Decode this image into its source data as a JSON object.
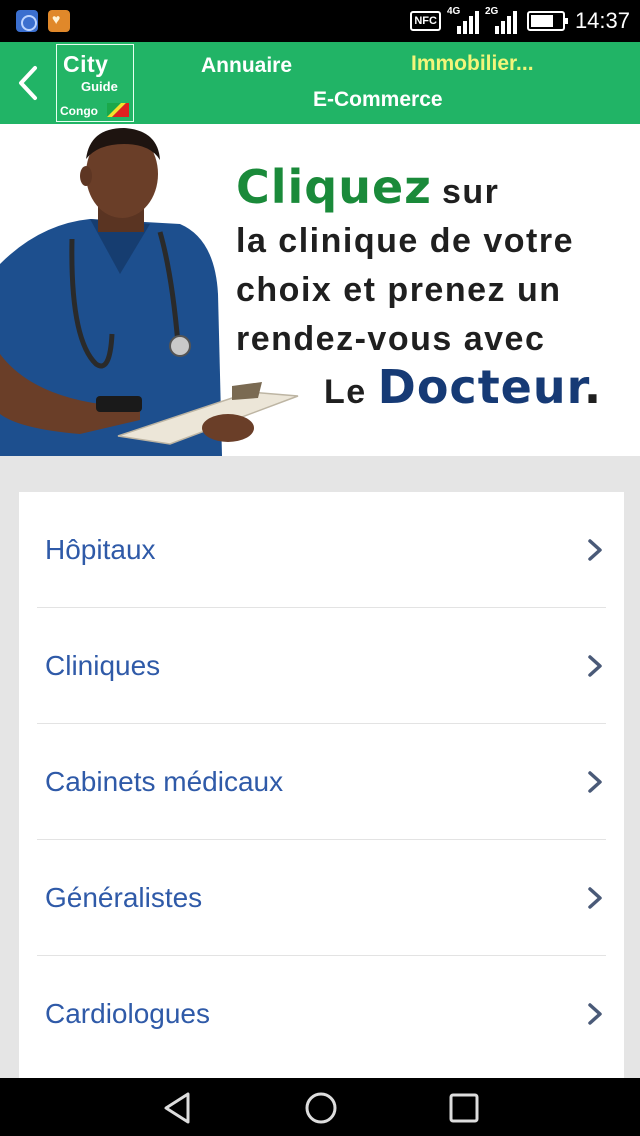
{
  "status_bar": {
    "nfc": "NFC",
    "network_1": "4G",
    "network_2": "2G",
    "time": "14:37"
  },
  "header": {
    "logo": {
      "line1": "City",
      "line2": "Guide",
      "line3": "Congo"
    },
    "links": {
      "annuaire": "Annuaire",
      "immobilier": "Immobilier...",
      "ecommerce": "E-Commerce"
    },
    "colors": {
      "background": "#21b466",
      "highlight": "#f3f57a"
    }
  },
  "banner": {
    "word_cliquez": "Cliquez",
    "word_sur": "sur",
    "line2": "la clinique de votre",
    "line3": "choix et prenez un",
    "line4": "rendez-vous avec",
    "word_le": "Le",
    "word_docteur": "Docteur",
    "period": "."
  },
  "list": {
    "items": [
      {
        "label": "Hôpitaux",
        "icon": "chevron-right-icon"
      },
      {
        "label": "Cliniques",
        "icon": "chevron-right-icon"
      },
      {
        "label": "Cabinets médicaux",
        "icon": "chevron-right-icon"
      },
      {
        "label": "Généralistes",
        "icon": "chevron-right-icon"
      },
      {
        "label": "Cardiologues",
        "icon": "chevron-right-icon"
      }
    ],
    "colors": {
      "text": "#2f5aa8"
    }
  },
  "navigation_bar": {
    "icons": [
      "back-triangle-icon",
      "home-circle-icon",
      "recents-square-icon"
    ]
  }
}
